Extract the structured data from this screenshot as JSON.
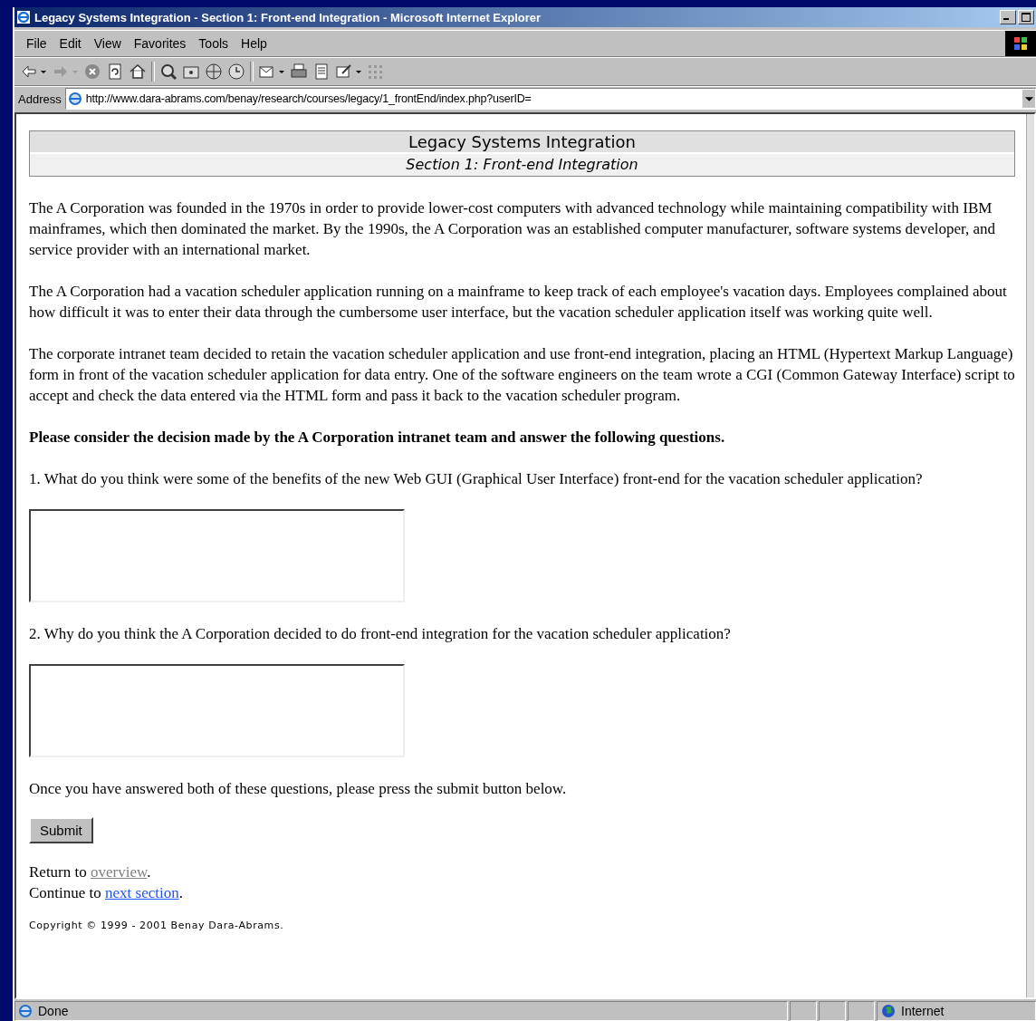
{
  "window": {
    "title": "Legacy Systems Integration - Section 1: Front-end Integration - Microsoft Internet Explorer"
  },
  "menu": [
    "File",
    "Edit",
    "View",
    "Favorites",
    "Tools",
    "Help"
  ],
  "address": {
    "label": "Address",
    "url": "http://www.dara-abrams.com/benay/research/courses/legacy/1_frontEnd/index.php?userID="
  },
  "page": {
    "header": {
      "title": "Legacy Systems Integration",
      "subtitle": "Section 1: Front-end Integration"
    },
    "paragraphs": [
      "The A Corporation was founded in the 1970s in order to provide lower-cost computers with advanced technology while maintaining compatibility with IBM mainframes, which then dominated the market. By the 1990s, the A Corporation was an established computer manufacturer, software systems developer, and service provider with an international market.",
      "The A Corporation had a vacation scheduler application running on a mainframe to keep track of each employee's vacation days. Employees complained about how difficult it was to enter their data through the cumbersome user interface, but the vacation scheduler application itself was working quite well.",
      "The corporate intranet team decided to retain the vacation scheduler application and use front-end integration, placing an HTML (Hypertext Markup Language) form in front of the vacation scheduler application for data entry. One of the software engineers on the team wrote a CGI (Common Gateway Interface) script to accept and check the data entered via the HTML form and pass it back to the vacation scheduler program."
    ],
    "instruction": "Please consider the decision made by the A Corporation intranet team and answer the following questions.",
    "questions": [
      "1. What do you think were some of the benefits of the new Web GUI (Graphical User Interface) front-end for the vacation scheduler application?",
      "2. Why do you think the A Corporation decided to do front-end integration for the vacation scheduler application?"
    ],
    "closing": "Once you have answered both of these questions, please press the submit button below.",
    "submit": "Submit",
    "nav_links": [
      {
        "before": "Return to ",
        "link": "overview",
        "after": ".",
        "visited": true
      },
      {
        "before": "Continue to ",
        "link": "next section",
        "after": ".",
        "visited": false
      }
    ],
    "copyright": "Copyright © 1999 - 2001 Benay Dara-Abrams."
  },
  "status_bar": {
    "text": "Done",
    "zone": "Internet"
  }
}
